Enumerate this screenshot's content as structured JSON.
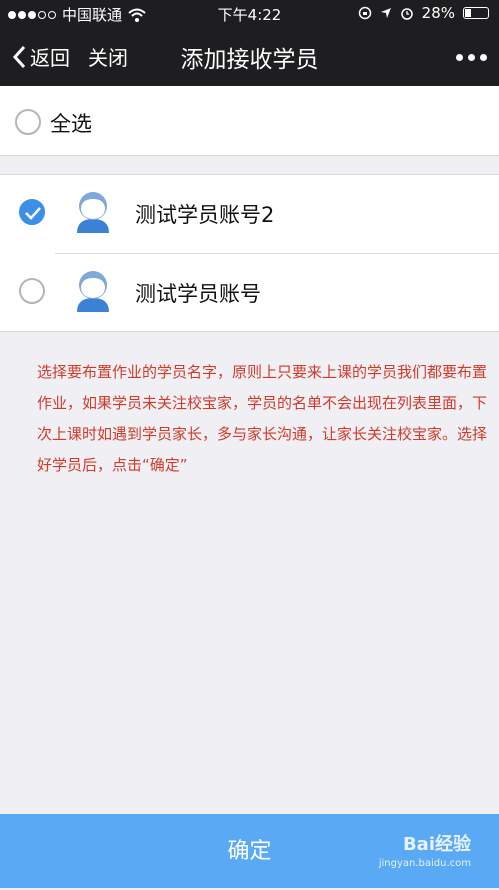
{
  "status_bar": {
    "carrier": "中国联通",
    "time": "下午4:22",
    "battery": "28%",
    "battery_level": 0.28
  },
  "nav": {
    "back_label": "返回",
    "close_label": "关闭",
    "title": "添加接收学员"
  },
  "select_all": {
    "label": "全选",
    "checked": false
  },
  "students": [
    {
      "name": "测试学员账号2",
      "checked": true
    },
    {
      "name": "测试学员账号",
      "checked": false
    }
  ],
  "hint": "选择要布置作业的学员名字，原则上只要来上课的学员我们都要布置作业，如果学员未关注校宝家，学员的名单不会出现在列表里面，下次上课时如遇到学员家长，多与家长沟通，让家长关注校宝家。选择好学员后，点击“确定”",
  "confirm_label": "确定",
  "watermark": {
    "brand": "Bai经验",
    "url": "jingyan.baidu.com"
  },
  "colors": {
    "accent": "#3b8fe6",
    "confirm_bg": "#5aa9f5",
    "hint_text": "#d23a2a",
    "nav_bg": "#1e1e20"
  }
}
